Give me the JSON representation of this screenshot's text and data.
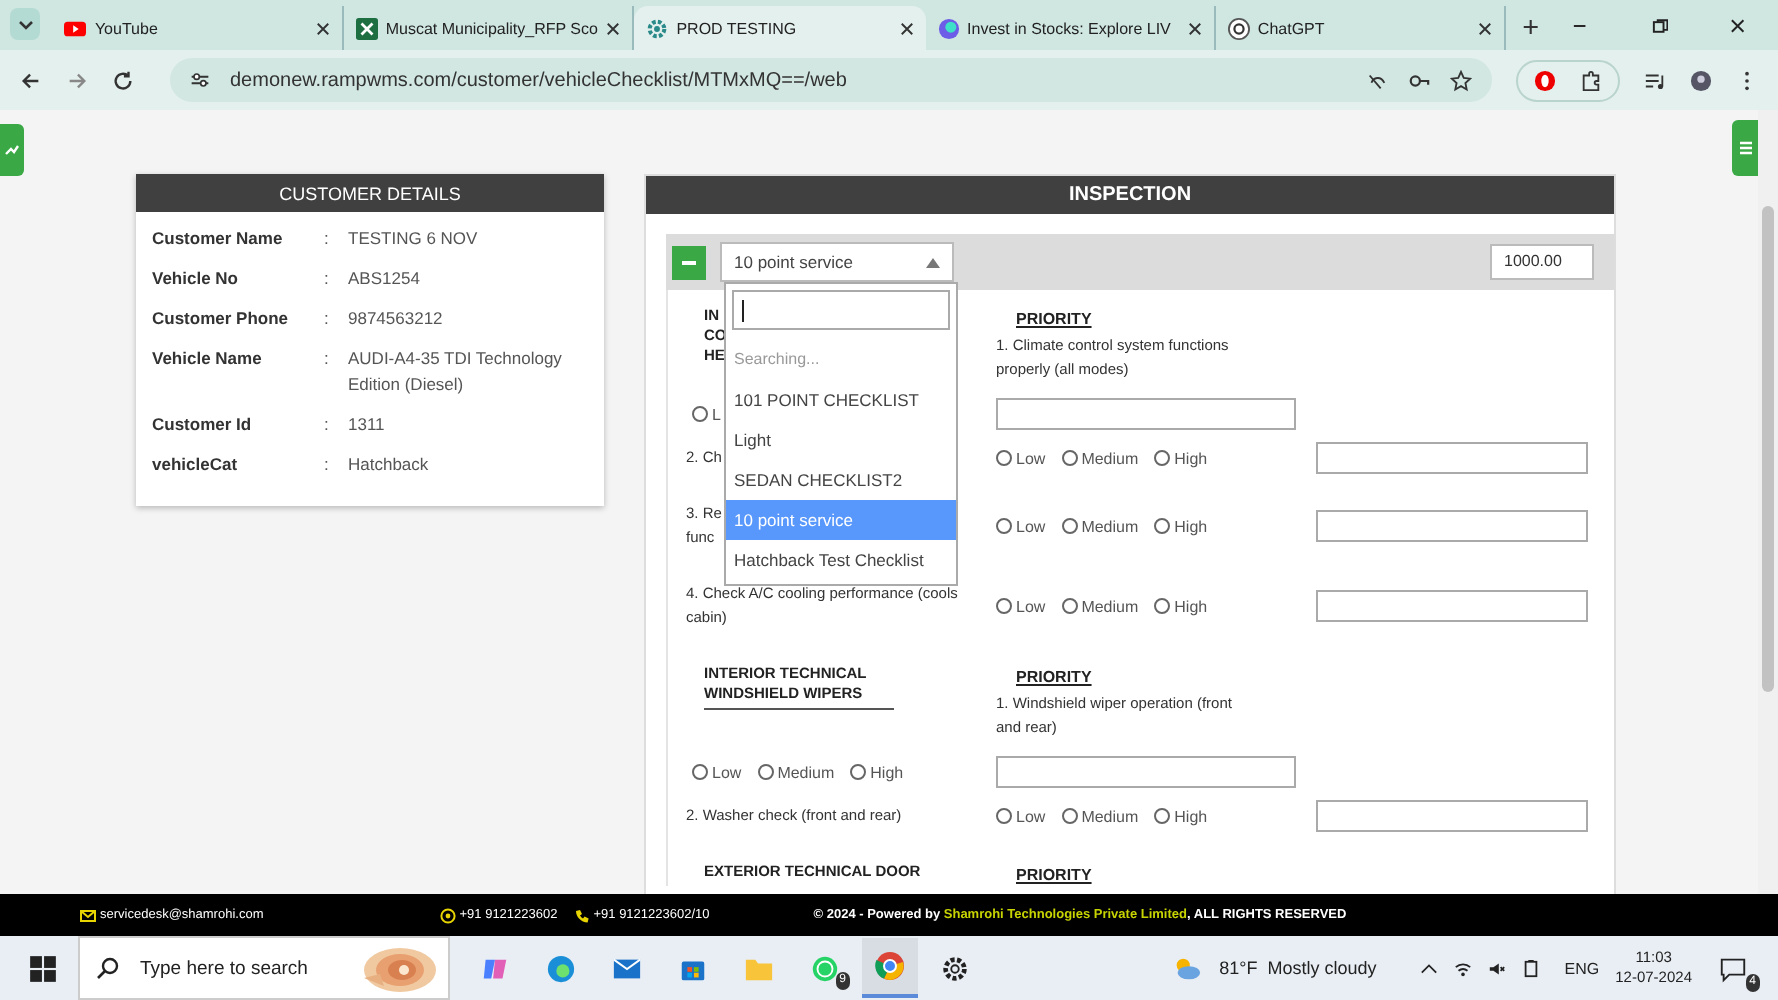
{
  "browser": {
    "tabs": [
      {
        "title": "YouTube",
        "kind": "youtube",
        "selected": false
      },
      {
        "title": "Muscat Municipality_RFP Sco",
        "kind": "excel",
        "selected": false
      },
      {
        "title": "PROD TESTING",
        "kind": "gear",
        "selected": true
      },
      {
        "title": "Invest in Stocks: Explore LIV",
        "kind": "orb",
        "selected": false
      },
      {
        "title": "ChatGPT",
        "kind": "knot",
        "selected": false
      }
    ],
    "address": "demonew.rampwms.com/customer/vehicleChecklist/MTMxMQ==/web"
  },
  "customer_details": {
    "title": "CUSTOMER DETAILS",
    "fields": [
      {
        "label": "Customer Name",
        "colon": ":",
        "value": "TESTING 6 NOV"
      },
      {
        "label": "Vehicle No",
        "colon": ":",
        "value": "ABS1254"
      },
      {
        "label": "Customer Phone",
        "colon": ":",
        "value": "9874563212"
      },
      {
        "label": "Vehicle Name",
        "colon": ":",
        "value": "AUDI-A4-35 TDI Technology Edition (Diesel)"
      },
      {
        "label": "Customer Id",
        "colon": ":",
        "value": "1311"
      },
      {
        "label": "vehicleCat",
        "colon": ":",
        "value": "Hatchback"
      }
    ]
  },
  "inspection": {
    "title": "INSPECTION",
    "expanded": true,
    "checklist_select": {
      "value": "10 point service",
      "open": true,
      "search_status": "Searching...",
      "options": [
        {
          "label": "101 POINT CHECKLIST",
          "selected": false
        },
        {
          "label": "Light",
          "selected": false
        },
        {
          "label": "SEDAN CHECKLIST2",
          "selected": false
        },
        {
          "label": "10 point service",
          "selected": true
        },
        {
          "label": "Hatchback Test Checklist",
          "selected": false
        }
      ]
    },
    "amount": "1000.00",
    "sections": [
      {
        "heading_lines": [
          "IN",
          "CO",
          "HE"
        ],
        "underlined": false,
        "priority_heading": "PRIORITY",
        "items": [
          {
            "kind": "lead",
            "text": "1. Climate control system functions properly (all modes)",
            "options": [
              {
                "label": "L",
                "selected": false
              }
            ]
          },
          {
            "kind": "row",
            "text": "2. Ch",
            "options": [
              {
                "label": "Low",
                "selected": false
              },
              {
                "label": "Medium",
                "selected": false
              },
              {
                "label": "High",
                "selected": false
              }
            ]
          },
          {
            "kind": "row",
            "text": "3. Re\nfunc",
            "options": [
              {
                "label": "Low",
                "selected": false
              },
              {
                "label": "Medium",
                "selected": false
              },
              {
                "label": "High",
                "selected": false
              }
            ]
          },
          {
            "kind": "row",
            "text": "4. Check A/C cooling performance (cools cabin)",
            "options": [
              {
                "label": "Low",
                "selected": false
              },
              {
                "label": "Medium",
                "selected": false
              },
              {
                "label": "High",
                "selected": false
              }
            ]
          }
        ]
      },
      {
        "heading_lines": [
          "INTERIOR TECHNICAL",
          "WINDSHIELD WIPERS"
        ],
        "underlined": true,
        "priority_heading": "PRIORITY",
        "items": [
          {
            "kind": "lead",
            "text": "1. Windshield wiper operation (front and rear)",
            "options": [
              {
                "label": "Low",
                "selected": false
              },
              {
                "label": "Medium",
                "selected": false
              },
              {
                "label": "High",
                "selected": false
              }
            ]
          },
          {
            "kind": "row",
            "text": "2. Washer check (front and rear)",
            "options": [
              {
                "label": "Low",
                "selected": false
              },
              {
                "label": "Medium",
                "selected": false
              },
              {
                "label": "High",
                "selected": false
              }
            ]
          }
        ]
      },
      {
        "heading_lines": [
          "EXTERIOR TECHNICAL DOOR"
        ],
        "underlined": false,
        "priority_heading": "PRIORITY"
      }
    ]
  },
  "footer": {
    "email": "servicedesk@shamrohi.com",
    "phone": "+91 9121223602",
    "phone_alt": "+91 9121223602/10",
    "copyright": "© 2024 - Powered by ",
    "company": "Shamrohi Technologies Private Limited",
    "rights": ", ALL RIGHTS RESERVED"
  },
  "taskbar": {
    "search_placeholder": "Type here to search",
    "whatsapp_badge": "9",
    "temperature": "81°F",
    "weather": "Mostly cloudy",
    "language": "ENG",
    "time": "11:03",
    "date": "12-07-2024",
    "notifications": "4"
  }
}
